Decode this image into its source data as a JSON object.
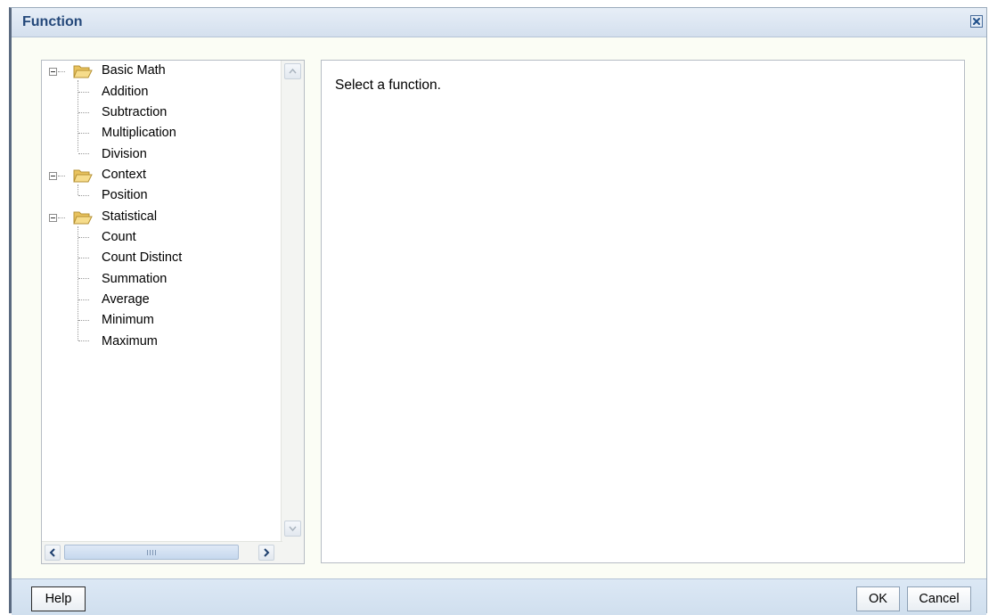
{
  "dialog": {
    "title": "Function"
  },
  "tree": [
    {
      "label": "Basic Math",
      "children": [
        "Addition",
        "Subtraction",
        "Multiplication",
        "Division"
      ]
    },
    {
      "label": "Context",
      "children": [
        "Position"
      ]
    },
    {
      "label": "Statistical",
      "children": [
        "Count",
        "Count Distinct",
        "Summation",
        "Average",
        "Minimum",
        "Maximum"
      ]
    }
  ],
  "main": {
    "message": "Select a function."
  },
  "footer": {
    "help_label": "Help",
    "ok_label": "OK",
    "cancel_label": "Cancel"
  },
  "icons": {
    "folder": "folder-open-icon",
    "close": "close-icon",
    "collapse": "collapse-icon"
  },
  "colors": {
    "title_text": "#24487a",
    "folder": "#f3d680",
    "dialog_bg": "#fbfdf5",
    "bar_bg": "#d4e0ee"
  }
}
